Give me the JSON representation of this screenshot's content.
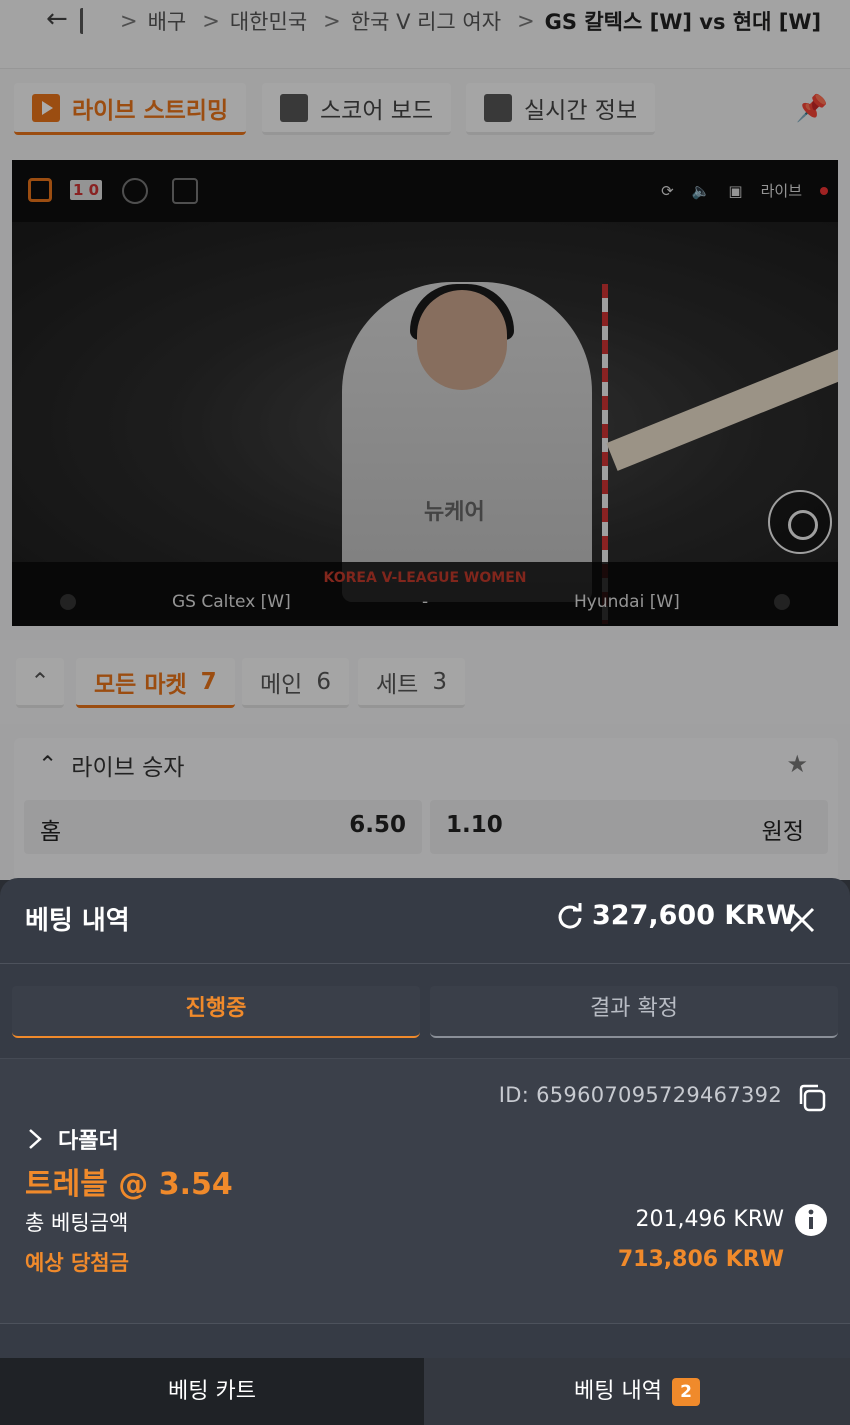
{
  "breadcrumb": {
    "items": [
      "배구",
      "대한민국",
      "한국 V 리그 여자"
    ],
    "current": "GS 칼텍스 [W] vs 현대 [W]"
  },
  "top_tabs": [
    {
      "label": "라이브 스트리밍",
      "icon": "play-icon",
      "active": true
    },
    {
      "label": "스코어 보드",
      "icon": "scoreboard-icon",
      "active": false
    },
    {
      "label": "실시간 정보",
      "icon": "stats-icon",
      "active": false
    }
  ],
  "video": {
    "score_badge": "1 0",
    "live_label": "라이브",
    "league": "KOREA V-LEAGUE WOMEN",
    "home_team": "GS Caltex [W]",
    "away_team": "Hyundai [W]",
    "score_sep": "-",
    "jersey_text": "뉴케어"
  },
  "market_tabs": [
    {
      "label": "모든 마켓",
      "count": "7",
      "active": true
    },
    {
      "label": "메인",
      "count": "6",
      "active": false
    },
    {
      "label": "세트",
      "count": "3",
      "active": false
    }
  ],
  "market": {
    "title": "라이브 승자",
    "home_label": "홈",
    "home_odds": "6.50",
    "away_odds": "1.10",
    "away_label": "원정"
  },
  "sheet": {
    "title": "베팅 내역",
    "balance": "327,600 KRW",
    "tabs": [
      {
        "label": "진행중",
        "active": true
      },
      {
        "label": "결과 확정",
        "active": false
      }
    ],
    "bet": {
      "id": "ID: 659607095729467392",
      "type": "다폴더",
      "odds_label": "트레블 @ 3.54",
      "stake_label": "총 베팅금액",
      "stake_value": "201,496 KRW",
      "payout_label": "예상 당첨금",
      "payout_value": "713,806 KRW"
    },
    "bottom": {
      "cart_label": "베팅 카트",
      "history_label": "베팅 내역",
      "history_count": "2"
    }
  },
  "colors": {
    "accent": "#f08a2b",
    "sheet_bg": "#363b45",
    "card_bg": "#3b404a"
  }
}
